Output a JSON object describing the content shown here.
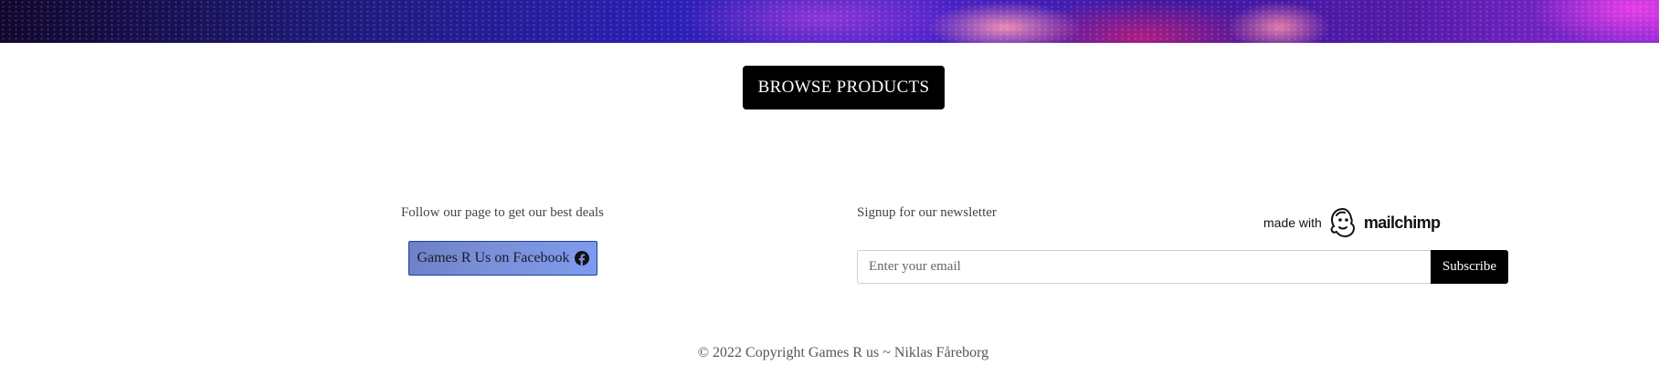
{
  "browse": {
    "label": "BROWSE PRODUCTS"
  },
  "social": {
    "follow_text": "Follow our page to get our best deals",
    "facebook_label": "Games R Us on Facebook"
  },
  "newsletter": {
    "title": "Signup for our newsletter",
    "email_placeholder": "Enter your email",
    "subscribe_label": "Subscribe",
    "badge_prefix": "made with",
    "badge_brand": "mailchimp"
  },
  "footer": {
    "copyright": "© 2022 Copyright Games R us ~ Niklas Fåreborg"
  },
  "icons": {
    "facebook": "facebook-icon",
    "mailchimp": "mailchimp-logo"
  },
  "colors": {
    "primary_button": "#000000",
    "facebook_button": "#7a90d8"
  }
}
